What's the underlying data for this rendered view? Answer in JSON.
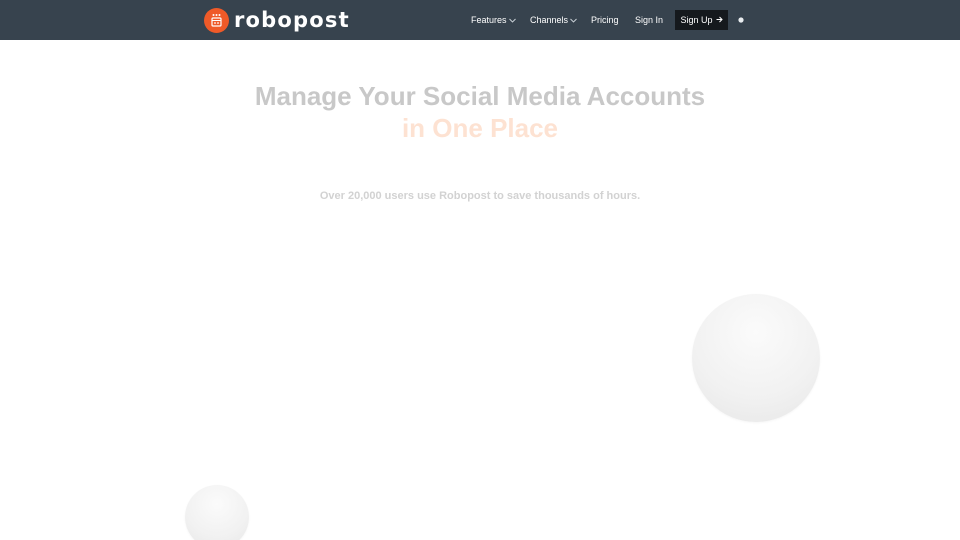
{
  "brand": {
    "name": "robopost"
  },
  "nav": {
    "features": "Features",
    "channels": "Channels",
    "pricing": "Pricing",
    "signin": "Sign In",
    "signup": "Sign Up"
  },
  "hero": {
    "title_line1": "Manage Your Social Media Accounts",
    "title_line2": "in One Place",
    "subtitle": "Over 20,000 users use Robopost to save thousands of hours."
  },
  "colors": {
    "navbar_bg": "#37434e",
    "brand_orange": "#ef5a28",
    "signup_bg": "#15191d",
    "title_gray": "#c8c8c8",
    "title_accent": "#fde2d2"
  },
  "icons": {
    "logo": "robot-calendar-icon",
    "dropdown": "chevron-down-icon",
    "signup_arrow": "arrow-right-icon",
    "theme": "sun-icon"
  }
}
